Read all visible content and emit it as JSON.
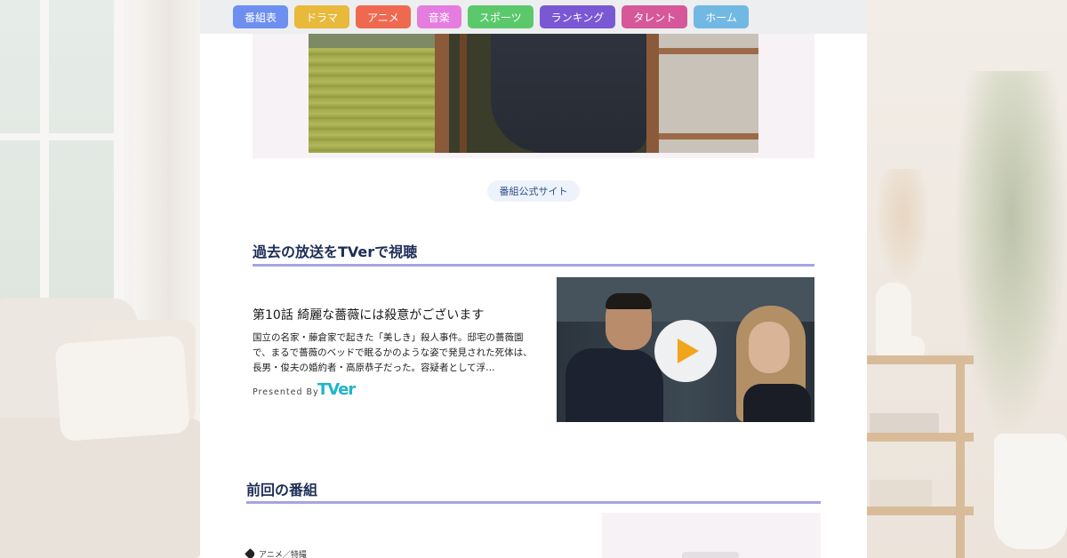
{
  "nav": {
    "items": [
      {
        "label": "番組表",
        "color": "#6c8ff0"
      },
      {
        "label": "ドラマ",
        "color": "#e8b93a"
      },
      {
        "label": "アニメ",
        "color": "#ef6951"
      },
      {
        "label": "音楽",
        "color": "#e57de0"
      },
      {
        "label": "スポーツ",
        "color": "#5bc96b"
      },
      {
        "label": "ランキング",
        "color": "#7a58d4"
      },
      {
        "label": "タレント",
        "color": "#d6579a"
      },
      {
        "label": "ホーム",
        "color": "#71b8e3"
      }
    ]
  },
  "hero": {
    "image": "drama-still-man-in-doorway"
  },
  "official_link": "番組公式サイト",
  "tver_section": {
    "heading": "過去の放送をTVerで視聴",
    "episode_title": "第10話 綺麗な薔薇には殺意がございます",
    "description": "国立の名家・藤倉家で起きた「美しき」殺人事件。邸宅の薔薇園で、まるで薔薇のベッドで眠るかのような姿で発見された死体は、長男・俊夫の婚約者・高原恭子だった。容疑者として浮…",
    "presented_by": "Presented By",
    "logo_text": "TVer",
    "video_icon": "play-icon"
  },
  "previous_section": {
    "heading": "前回の番組",
    "tag": "アニメ／特撮",
    "tag_icon": "tag-icon"
  }
}
